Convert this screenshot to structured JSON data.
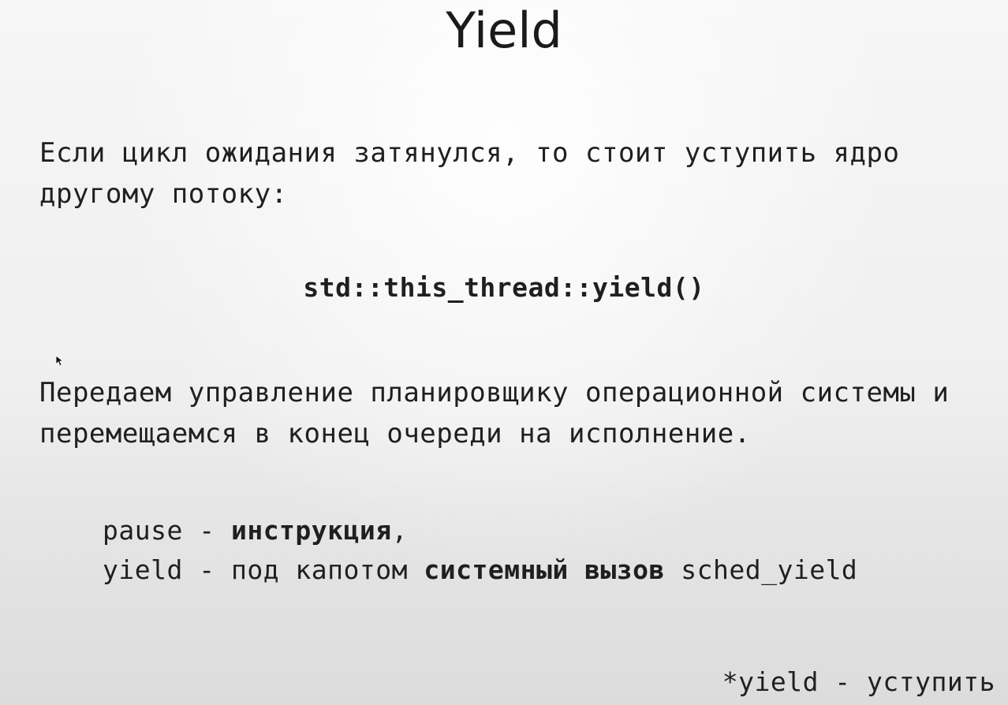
{
  "slide": {
    "title": "Yield",
    "intro": "Если цикл ожидания затянулся, то стоит уступить ядро другому потоку:",
    "code": "std::this_thread::yield()",
    "description": "Передаем управление планировщику операционной системы и перемещаемся в конец очереди на исполнение.",
    "notes": {
      "pause_term": "pause",
      "pause_dash": " - ",
      "pause_bold": "инструкция",
      "pause_tail": ",",
      "yield_term": "yield",
      "yield_dash": " - ",
      "yield_mid": "под капотом ",
      "yield_bold": "системный вызов",
      "yield_tail": " sched_yield"
    },
    "footnote": "*yield - уступить"
  },
  "icons": {
    "cursor": "mouse-pointer-icon"
  }
}
